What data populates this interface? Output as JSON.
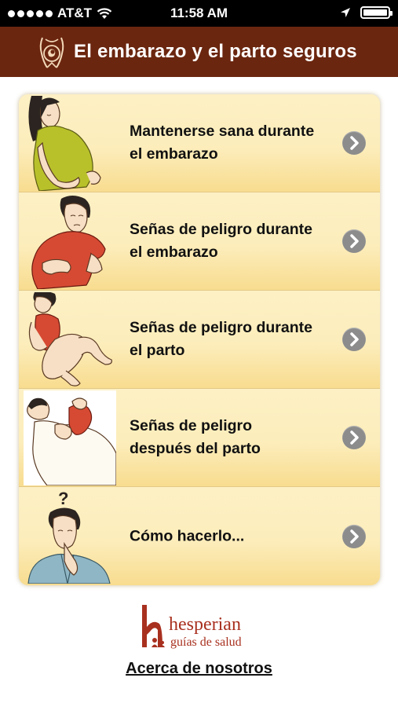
{
  "status_bar": {
    "carrier": "AT&T",
    "time": "11:58 AM"
  },
  "nav": {
    "title": "El embarazo y el parto seguros"
  },
  "menu": {
    "items": [
      {
        "label_line1": "Mantenerse sana durante",
        "label_line2": "el embarazo",
        "illustration": "pregnant-woman-green-shirt"
      },
      {
        "label_line1": "Señas de peligro durante",
        "label_line2": "el embarazo",
        "illustration": "pregnant-woman-red-shirt"
      },
      {
        "label_line1": "Señas de peligro durante",
        "label_line2": "el parto",
        "illustration": "woman-giving-birth"
      },
      {
        "label_line1": "Señas de peligro",
        "label_line2": "después del parto",
        "illustration": "mother-with-newborn"
      },
      {
        "label_line1": "Cómo hacerlo...",
        "label_line2": "",
        "illustration": "woman-thinking"
      }
    ],
    "chevron_icon": "chevron-right-icon"
  },
  "footer": {
    "logo_text": "hesperian",
    "logo_subtext": "guías de salud",
    "about_link": "Acerca de nosotros"
  },
  "colors": {
    "nav_background": "#6b260f",
    "card_background": "#fdf0c4",
    "brand_red": "#a8301f"
  }
}
